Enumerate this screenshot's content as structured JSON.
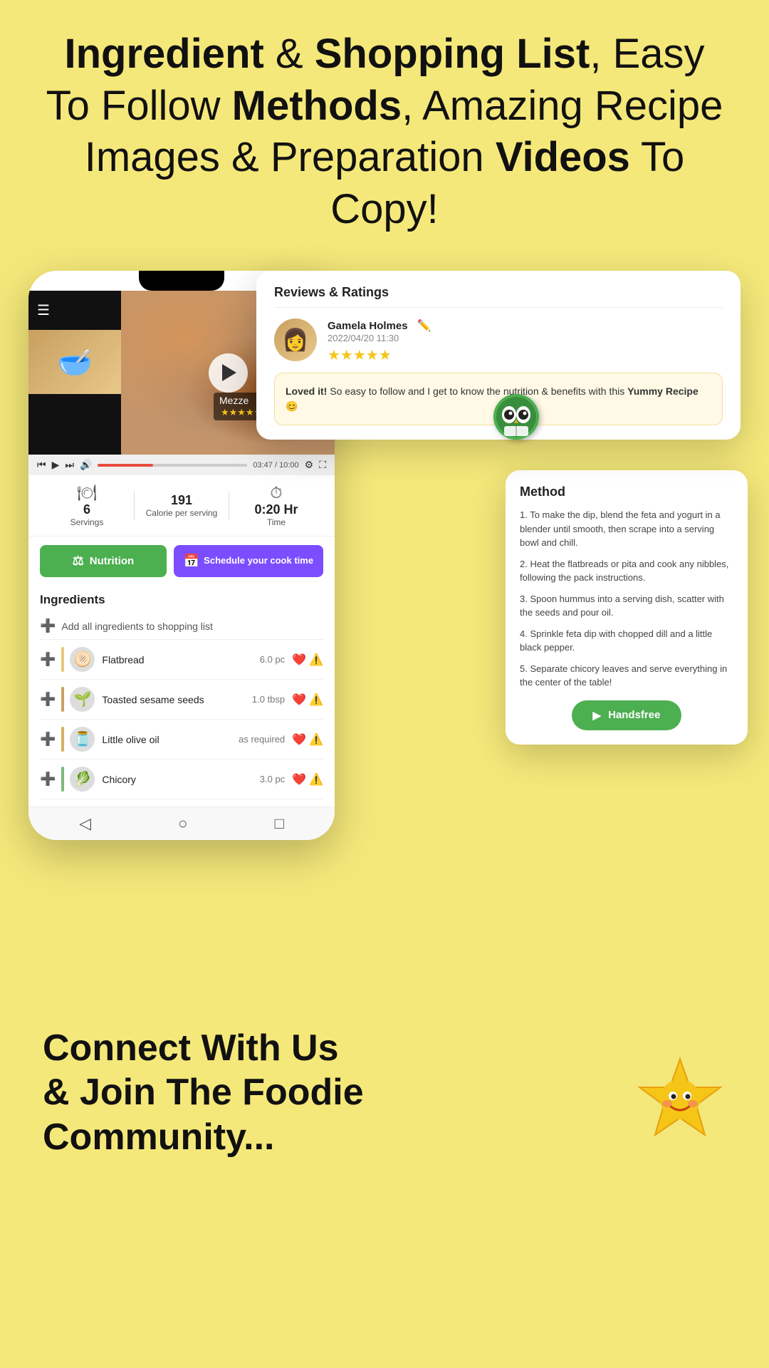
{
  "header": {
    "line1_part1": "Ingredient",
    "line1_amp": " & ",
    "line1_part2": "Shopping List",
    "line1_part3": ", Easy",
    "line2_part1": "To Follow ",
    "line2_part2": "Methods",
    "line2_part3": ", Amazing Recipe",
    "line3_part1": "Images & Preparation ",
    "line3_part2": "Videos",
    "line3_part3": " To Copy!"
  },
  "video": {
    "recipe_name": "Mezze",
    "stars": "★★★★☆",
    "time_current": "03:47",
    "time_total": "10:00"
  },
  "stats": {
    "servings_label": "Servings",
    "servings_value": "6",
    "calories_label": "Calorie per serving",
    "calories_value": "191",
    "time_label": "Time",
    "time_value": "0:20 Hr"
  },
  "buttons": {
    "nutrition": "Nutrition",
    "schedule": "Schedule your cook time"
  },
  "ingredients": {
    "title": "Ingredients",
    "add_all": "Add all ingredients to shopping list",
    "items": [
      {
        "name": "Flatbread",
        "qty": "6.0 pc",
        "emoji": "🫓",
        "color": "#e8c87a"
      },
      {
        "name": "Toasted sesame seeds",
        "qty": "1.0 tbsp",
        "emoji": "🌱",
        "color": "#c8a060"
      },
      {
        "name": "Little olive oil",
        "qty": "as required",
        "emoji": "🫙",
        "color": "#d4b060"
      },
      {
        "name": "Chicory",
        "qty": "3.0 pc",
        "emoji": "🥬",
        "color": "#7db87d"
      }
    ]
  },
  "method": {
    "title": "Method",
    "steps": [
      "1. To make the dip, blend the feta and yogurt in a blender until smooth, then scrape into a serving bowl and chill.",
      "2. Heat the flatbreads or pita and cook any nibbles, following the pack instructions.",
      "3. Spoon hummus into a serving dish, scatter with the seeds and pour oil.",
      "4. Sprinkle feta dip with chopped dill and a little black pepper.",
      "5. Separate chicory leaves and serve everything in the center of the table!"
    ],
    "handsfree_btn": "Handsfree"
  },
  "reviews": {
    "title": "Reviews & Ratings",
    "reviewer": {
      "name": "Gamela Holmes",
      "date": "2022/04/20 11:30",
      "stars": "★★★★★",
      "text_part1": "Loved it!",
      "text_part2": " So easy to follow and I get to know the nutrition & benefits with this ",
      "text_bold": "Yummy Recipe",
      "text_emoji": "😊"
    }
  },
  "bottom": {
    "line1": "Connect With Us",
    "line2": "& Join The Foodie",
    "line3": "Community..."
  }
}
